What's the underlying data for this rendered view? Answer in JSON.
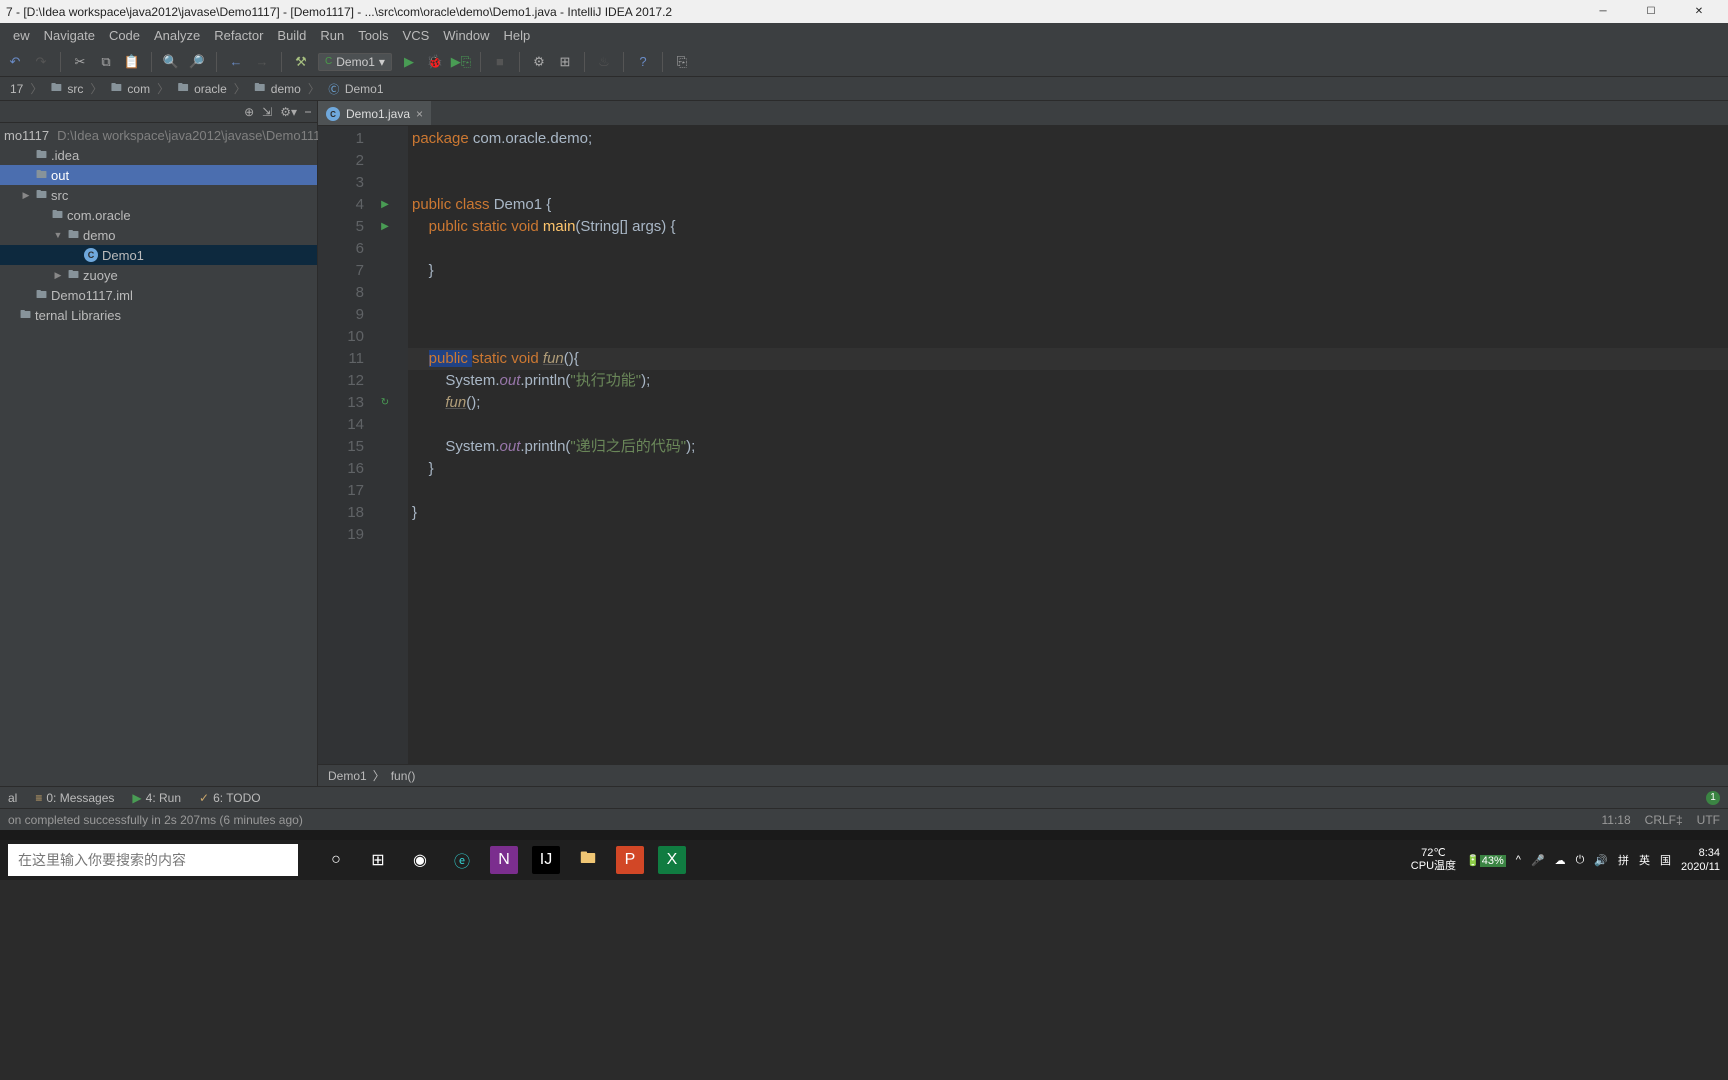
{
  "titlebar": {
    "text": "7 - [D:\\Idea workspace\\java2012\\javase\\Demo1117] - [Demo1117] - ...\\src\\com\\oracle\\demo\\Demo1.java - IntelliJ IDEA 2017.2"
  },
  "menu": [
    "ew",
    "Navigate",
    "Code",
    "Analyze",
    "Refactor",
    "Build",
    "Run",
    "Tools",
    "VCS",
    "Window",
    "Help"
  ],
  "run_config": "Demo1",
  "breadcrumbs": [
    "17",
    "src",
    "com",
    "oracle",
    "demo",
    "Demo1"
  ],
  "tree": {
    "root": {
      "name": "mo1117",
      "path": "D:\\Idea workspace\\java2012\\javase\\Demo1117"
    },
    "items": [
      {
        "indent": 1,
        "icon": "folder",
        "name": ".idea"
      },
      {
        "indent": 1,
        "icon": "folder",
        "name": "out",
        "hov": true
      },
      {
        "indent": 1,
        "icon": "folder",
        "name": "src",
        "arrow": "▶"
      },
      {
        "indent": 2,
        "icon": "folder",
        "name": "com.oracle"
      },
      {
        "indent": 3,
        "icon": "folder",
        "name": "demo",
        "arrow": "▼"
      },
      {
        "indent": 4,
        "icon": "class",
        "name": "Demo1",
        "sel": true
      },
      {
        "indent": 3,
        "icon": "folder",
        "name": "zuoye",
        "arrow": "▶"
      },
      {
        "indent": 1,
        "icon": "file",
        "name": "Demo1117.iml"
      },
      {
        "indent": 0,
        "icon": "lib",
        "name": "ternal Libraries"
      }
    ]
  },
  "tab": {
    "name": "Demo1.java"
  },
  "gutter": {
    "lines": [
      "1",
      "2",
      "3",
      "4",
      "5",
      "6",
      "7",
      "8",
      "9",
      "10",
      "11",
      "12",
      "13",
      "14",
      "15",
      "16",
      "17",
      "18",
      "19"
    ],
    "marks": {
      "4": "▶",
      "5": "▶",
      "13": "↻"
    }
  },
  "code": {
    "l1a": "package ",
    "l1b": "com.oracle.demo;",
    "l4a": "public class ",
    "l4b": "Demo1 {",
    "l5a": "public static void ",
    "l5b": "main",
    "l5c": "(String[] args) {",
    "l7": "}",
    "l11a": "public ",
    "l11b": "static",
    "l11c": " void ",
    "l11d": "fun",
    "l11e": "(){",
    "l12a": "System.",
    "l12b": "out",
    "l12c": ".println(",
    "l12d": "\"执行功能\"",
    "l12e": ");",
    "l13a": "fun",
    "l13b": "();",
    "l15a": "System.",
    "l15b": "out",
    "l15c": ".println(",
    "l15d": "\"递归之后的代码\"",
    "l15e": ");",
    "l16": "}",
    "l18": "}"
  },
  "crumb_bottom": [
    "Demo1",
    "fun()"
  ],
  "toolwin": {
    "term": "al",
    "msg": "0: Messages",
    "run": "4: Run",
    "todo": "6: TODO"
  },
  "status": {
    "msg": "on completed successfully in 2s 207ms (6 minutes ago)",
    "pos": "11:18",
    "le": "CRLF‡",
    "enc": "UTF"
  },
  "taskbar": {
    "search_placeholder": "在这里输入你要搜索的内容",
    "temp": "72℃",
    "templabel": "CPU温度",
    "battery": "43%",
    "ime": "英",
    "nat": "国",
    "time": "8:34",
    "date": "2020/11"
  }
}
